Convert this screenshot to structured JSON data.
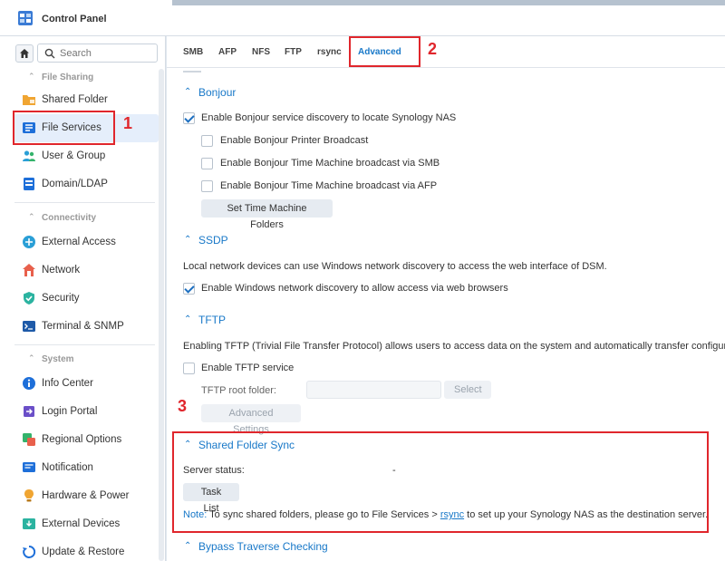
{
  "window": {
    "title": "Control Panel"
  },
  "sidebar": {
    "search_placeholder": "Search",
    "sections": [
      {
        "label": "File Sharing",
        "items": [
          {
            "label": "Shared Folder",
            "icon": "shared-folder-icon"
          },
          {
            "label": "File Services",
            "icon": "file-services-icon",
            "active": true
          },
          {
            "label": "User & Group",
            "icon": "user-group-icon"
          },
          {
            "label": "Domain/LDAP",
            "icon": "domain-ldap-icon"
          }
        ]
      },
      {
        "label": "Connectivity",
        "items": [
          {
            "label": "External Access",
            "icon": "external-access-icon"
          },
          {
            "label": "Network",
            "icon": "network-icon"
          },
          {
            "label": "Security",
            "icon": "security-shield-icon"
          },
          {
            "label": "Terminal & SNMP",
            "icon": "terminal-icon"
          }
        ]
      },
      {
        "label": "System",
        "items": [
          {
            "label": "Info Center",
            "icon": "info-icon"
          },
          {
            "label": "Login Portal",
            "icon": "login-portal-icon"
          },
          {
            "label": "Regional Options",
            "icon": "regional-options-icon"
          },
          {
            "label": "Notification",
            "icon": "notification-icon"
          },
          {
            "label": "Hardware & Power",
            "icon": "hardware-power-icon"
          },
          {
            "label": "External Devices",
            "icon": "external-devices-icon"
          },
          {
            "label": "Update & Restore",
            "icon": "update-restore-icon"
          }
        ]
      }
    ]
  },
  "tabs": [
    "SMB",
    "AFP",
    "NFS",
    "FTP",
    "rsync",
    "Advanced"
  ],
  "bonjour": {
    "title": "Bonjour",
    "discovery": "Enable Bonjour service discovery to locate Synology NAS",
    "printer": "Enable Bonjour Printer Broadcast",
    "tm_smb": "Enable Bonjour Time Machine broadcast via SMB",
    "tm_afp": "Enable Bonjour Time Machine broadcast via AFP",
    "tm_button": "Set Time Machine Folders"
  },
  "ssdp": {
    "title": "SSDP",
    "desc": "Local network devices can use Windows network discovery to access the web interface of DSM.",
    "enable": "Enable Windows network discovery to allow access via web browsers"
  },
  "tftp": {
    "title": "TFTP",
    "desc": "Enabling TFTP (Trivial File Transfer Protocol) allows users to access data on the system and automatically transfer configurat",
    "enable": "Enable TFTP service",
    "root_label": "TFTP root folder:",
    "select_button": "Select",
    "advanced_button": "Advanced Settings"
  },
  "sync": {
    "title": "Shared Folder Sync",
    "status_label": "Server status:",
    "status_value": "-",
    "task_button": "Task List",
    "note_prefix": "Note:",
    "note_text": " To sync shared folders, please go to File Services > ",
    "note_link": "rsync",
    "note_suffix": " to set up your Synology NAS as the destination server."
  },
  "bypass": {
    "title": "Bypass Traverse Checking"
  },
  "annotations": {
    "one": "1",
    "two": "2",
    "three": "3"
  },
  "colors": {
    "accent": "#1878c8",
    "callout": "#e0262c"
  }
}
